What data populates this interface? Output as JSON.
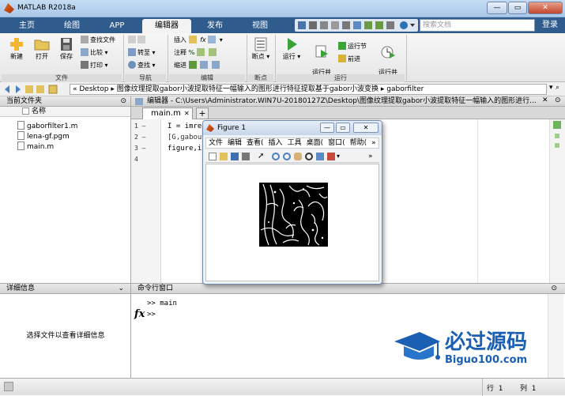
{
  "window": {
    "title": "MATLAB R2018a"
  },
  "tabs": [
    "主页",
    "绘图",
    "APP",
    "编辑器",
    "发布",
    "视图"
  ],
  "active_tab": "编辑器",
  "search": {
    "placeholder": "搜索文档"
  },
  "login": "登录",
  "ribbon": {
    "file_group": {
      "label": "文件",
      "new": "新建",
      "open": "打开",
      "save": "保存",
      "find_files": "查找文件",
      "compare": "比较",
      "print": "打印"
    },
    "nav_group": {
      "label": "导航",
      "goto": "转至",
      "find": "查找"
    },
    "edit_group": {
      "label": "编辑",
      "insert": "插入",
      "comment": "注释",
      "indent": "缩进"
    },
    "breakpoint_group": {
      "label": "断点",
      "breakpoints": "断点"
    },
    "run_group": {
      "label": "运行",
      "run": "运行",
      "run_advance": "运行并\n前进",
      "run_section": "运行节",
      "advance": "前进",
      "run_time": "运行并\n计时"
    }
  },
  "address": {
    "path": "« Desktop ▸ 图像纹理提取gabor小波提取特征一幅输入的图形进行特征提取基于gabor小波变换 ▸ gaborfilter"
  },
  "current_folder": {
    "title": "当前文件夹",
    "column": "名称",
    "files": [
      "gaborfilter1.m",
      "lena-gf.pgm",
      "main.m"
    ]
  },
  "details": {
    "title": "详细信息",
    "hint": "选择文件以查看详细信息"
  },
  "editor": {
    "header": "编辑器 - C:\\Users\\Administrator.WIN7U-20180127Z\\Desktop\\图像纹理提取gabor小波提取特征一幅输入的图形进行...",
    "tab": "main.m",
    "tab_plus": "+",
    "line_numbers": [
      "1 —",
      "2 —",
      "3 —",
      "4"
    ],
    "lines": [
      "I = imre",
      "[G,gabou",
      "figure,i",
      ""
    ]
  },
  "figure": {
    "title": "Figure 1",
    "menu": [
      "文件",
      "编辑",
      "查看(",
      "插入",
      "工具",
      "桌面(",
      "窗口(",
      "帮助(",
      "»"
    ]
  },
  "command_window": {
    "title": "命令行窗口",
    "lines": [
      ">> main",
      ">>"
    ],
    "fx": "fx"
  },
  "status": {
    "row_label": "行",
    "row": "1",
    "col_label": "列",
    "col": "1"
  },
  "watermark": {
    "title": "必过源码",
    "url": "Biguo100.com"
  },
  "colors": {
    "tab_bar": "#2f5c8c",
    "accent": "#1a6fc4",
    "watermark": "#1a5fb4"
  }
}
